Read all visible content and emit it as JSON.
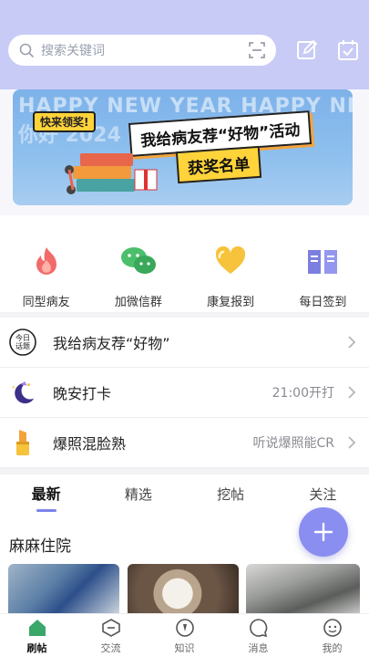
{
  "search": {
    "placeholder": "搜索关键词"
  },
  "header": {
    "icons": [
      "scan-icon",
      "edit-icon",
      "calendar-check-icon"
    ]
  },
  "banner": {
    "bg_line1": "HAPPY NEW YEAR   HAPPY NE",
    "bg_line2": "你好 2024",
    "tag": "快来领奖!",
    "headline": "我给病友荐“好物”活动",
    "subline": "获奖名单"
  },
  "quick": [
    {
      "label": "同型病友",
      "icon": "flame-icon"
    },
    {
      "label": "加微信群",
      "icon": "wechat-icon"
    },
    {
      "label": "康复报到",
      "icon": "heart-icon"
    },
    {
      "label": "每日签到",
      "icon": "book-icon"
    }
  ],
  "list": [
    {
      "title": "我给病友荐“好物”",
      "meta": "",
      "icon": "today-topic-icon"
    },
    {
      "title": "晚安打卡",
      "meta": "21:00开打",
      "icon": "moon-icon"
    },
    {
      "title": "爆照混脸熟",
      "meta": "听说爆照能CR",
      "icon": "lipstick-icon"
    }
  ],
  "tabs": [
    "最新",
    "精选",
    "挖帖",
    "关注"
  ],
  "active_tab": 0,
  "feed": {
    "title": "麻麻住院"
  },
  "nav": [
    {
      "label": "刷帖",
      "icon": "home-icon",
      "active": true
    },
    {
      "label": "交流",
      "icon": "chat-minus-icon",
      "active": false
    },
    {
      "label": "知识",
      "icon": "knowledge-icon",
      "active": false
    },
    {
      "label": "消息",
      "icon": "message-icon",
      "active": false
    },
    {
      "label": "我的",
      "icon": "profile-icon",
      "active": false
    }
  ],
  "colors": {
    "accent": "#7e83ea",
    "header": "#c8cbf5",
    "fab": "#8a8ef0",
    "nav_active": "#3aa86b"
  }
}
